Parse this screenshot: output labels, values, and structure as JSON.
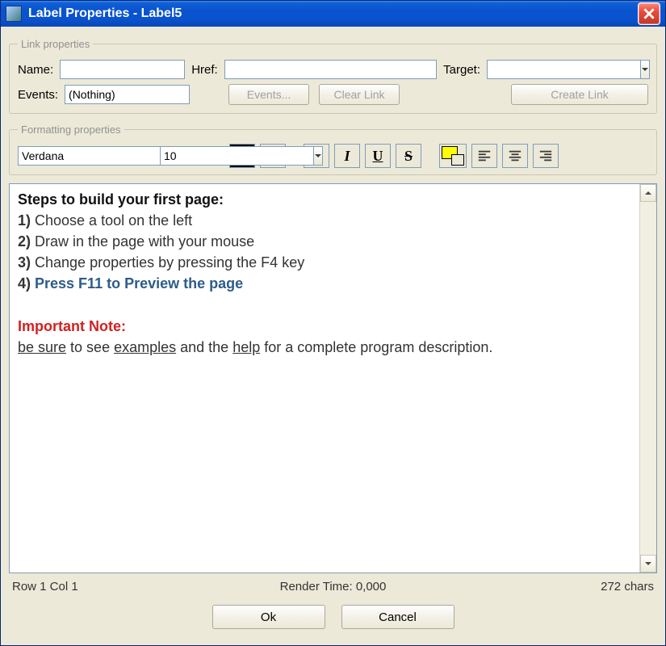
{
  "window": {
    "title": "Label Properties - Label5"
  },
  "link": {
    "legend": "Link properties",
    "name_label": "Name:",
    "name_value": "",
    "href_label": "Href:",
    "href_value": "",
    "target_label": "Target:",
    "target_value": "",
    "events_label": "Events:",
    "events_value": "(Nothing)",
    "events_btn": "Events...",
    "clear_btn": "Clear Link",
    "create_btn": "Create Link"
  },
  "format": {
    "legend": "Formatting properties",
    "font": "Verdana",
    "size": "10",
    "text_color": "#000000",
    "bg_color": "#ffff00"
  },
  "editor": {
    "heading": "Steps to build your first page:",
    "step1_no": "1)",
    "step1_text": " Choose a tool on the left",
    "step2_no": "2)",
    "step2_text": " Draw in the page with your mouse",
    "step3_no": "3)",
    "step3_text": " Change properties by pressing the F4 key",
    "step4_no": "4) ",
    "step4_text": "Press F11 to Preview the page",
    "important_label": "Important Note:",
    "tail_1": "be sure",
    "tail_2": " to see ",
    "tail_3": "examples",
    "tail_4": " and the ",
    "tail_5": "help",
    "tail_6": " for a complete program description."
  },
  "status": {
    "pos": "Row 1  Col 1",
    "render": "Render Time: 0,000",
    "chars": "272 chars"
  },
  "buttons": {
    "ok": "Ok",
    "cancel": "Cancel"
  }
}
